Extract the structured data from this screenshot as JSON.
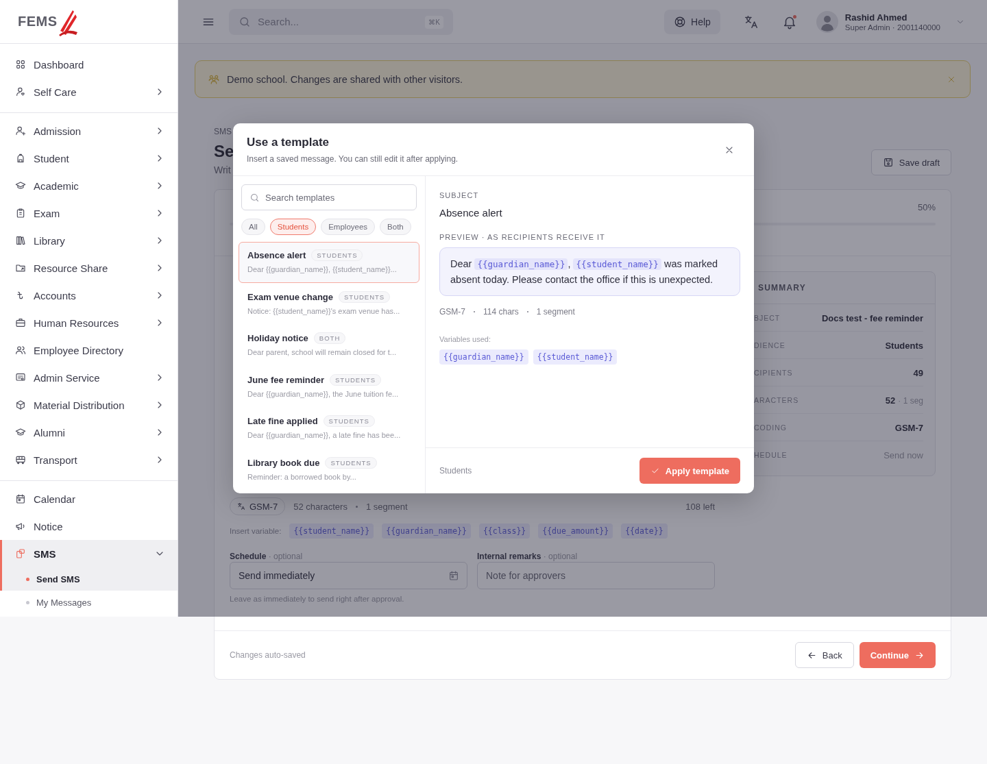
{
  "sidebar": {
    "logo": "FEMS",
    "groups": [
      {
        "items": [
          {
            "label": "Dashboard",
            "selected": false
          },
          {
            "label": "Self Care",
            "selected": false,
            "expanded": false
          }
        ]
      },
      {
        "items": [
          {
            "label": "Admission",
            "selected": false,
            "expanded": false
          },
          {
            "label": "Student",
            "selected": false,
            "expanded": false
          },
          {
            "label": "Academic",
            "selected": false,
            "expanded": false
          },
          {
            "label": "Exam",
            "selected": false,
            "expanded": false
          },
          {
            "label": "Library",
            "selected": false,
            "expanded": false
          },
          {
            "label": "Resource Share",
            "selected": false,
            "expanded": false
          },
          {
            "label": "Accounts",
            "selected": false,
            "expanded": false
          },
          {
            "label": "Human Resources",
            "selected": false,
            "expanded": false
          },
          {
            "label": "Employee Directory",
            "selected": false
          },
          {
            "label": "Admin Service",
            "selected": false,
            "expanded": false
          },
          {
            "label": "Material Distribution",
            "selected": false,
            "expanded": false
          },
          {
            "label": "Alumni",
            "selected": false,
            "expanded": false
          },
          {
            "label": "Transport",
            "selected": false,
            "expanded": false
          }
        ]
      },
      {
        "items": [
          {
            "label": "Calendar",
            "selected": false
          },
          {
            "label": "Notice",
            "selected": false
          },
          {
            "label": "SMS",
            "selected": true,
            "expanded": true,
            "children": [
              {
                "label": "Send SMS",
                "selected": true
              },
              {
                "label": "My Messages",
                "selected": false
              }
            ]
          }
        ]
      }
    ]
  },
  "topbar": {
    "search": {
      "placeholder": "Search...",
      "shortcut": "⌘K"
    },
    "help": "Help",
    "notifications_unread": true,
    "user": {
      "name": "Rashid Ahmed",
      "role": "Super Admin · 2001140000"
    }
  },
  "banner": {
    "text": "Demo school. Changes are shared with other visitors."
  },
  "page": {
    "breadcrumb": "SMS",
    "title": "Se",
    "subtitle": "Writ",
    "save_draft": "Save draft",
    "progress_reading": "50%",
    "composer": {
      "encoding": "GSM-7",
      "counters": [
        "52 characters",
        "1 segment"
      ],
      "remaining": "108 left",
      "insert_label": "Insert variable:",
      "variables": [
        "{{student_name}}",
        "{{guardian_name}}",
        "{{class}}",
        "{{due_amount}}",
        "{{date}}"
      ],
      "schedule": {
        "label": "Schedule",
        "note": "· optional",
        "value": "Send immediately",
        "hint": "Leave as immediately to send right after approval."
      },
      "remarks": {
        "label": "Internal remarks",
        "note": "· optional",
        "placeholder": "Note for approvers"
      }
    },
    "summary": {
      "title": "SUMMARY",
      "rows": [
        {
          "label": "BJECT",
          "value": "Docs test - fee reminder",
          "muted": false
        },
        {
          "label": "DIENCE",
          "value": "Students",
          "muted": false
        },
        {
          "label": "CIPIENTS",
          "value": "49",
          "muted": false
        },
        {
          "label": "ARACTERS",
          "value": "52",
          "note": "· 1 seg",
          "muted": false
        },
        {
          "label": "CODING",
          "value": "GSM-7",
          "muted": false
        },
        {
          "label": "HEDULE",
          "value": "Send now",
          "muted": true
        }
      ]
    },
    "footer": {
      "status": "Changes auto-saved",
      "back": "Back",
      "continue": "Continue"
    }
  },
  "template_dialog": {
    "title": "Use a template",
    "subtitle": "Insert a saved message. You can still edit it after applying.",
    "search": {
      "placeholder": "Search templates"
    },
    "filters": [
      {
        "label": "All",
        "selected": false
      },
      {
        "label": "Students",
        "selected": true
      },
      {
        "label": "Employees",
        "selected": false
      },
      {
        "label": "Both",
        "selected": false
      }
    ],
    "templates": [
      {
        "name": "Absence alert",
        "audience": "STUDENTS",
        "excerpt": "Dear {{guardian_name}}, {{student_name}}...",
        "selected": true
      },
      {
        "name": "Exam venue change",
        "audience": "STUDENTS",
        "excerpt": "Notice: {{student_name}}'s exam venue has...",
        "selected": false
      },
      {
        "name": "Holiday notice",
        "audience": "BOTH",
        "excerpt": "Dear parent, school will remain closed for t...",
        "selected": false
      },
      {
        "name": "June fee reminder",
        "audience": "STUDENTS",
        "excerpt": "Dear {{guardian_name}}, the June tuition fe...",
        "selected": false
      },
      {
        "name": "Late fine applied",
        "audience": "STUDENTS",
        "excerpt": "Dear {{guardian_name}}, a late fine has bee...",
        "selected": false
      },
      {
        "name": "Library book due",
        "audience": "STUDENTS",
        "excerpt": "Reminder: a borrowed book by...",
        "selected": false
      }
    ],
    "subject_label": "SUBJECT",
    "subject": "Absence alert",
    "preview_label": "PREVIEW · AS RECIPIENTS RECEIVE IT",
    "preview": [
      {
        "kind": "text",
        "text": "Dear"
      },
      {
        "kind": "variable",
        "text": "{{guardian_name}}"
      },
      {
        "kind": "text",
        "text": ","
      },
      {
        "kind": "variable",
        "text": "{{student_name}}"
      },
      {
        "kind": "text",
        "text": "was marked absent today. Please contact the office if this is unexpected."
      }
    ],
    "stats": [
      "GSM-7",
      "114 chars",
      "1 segment"
    ],
    "variables_label": "Variables used:",
    "variables": [
      "{{guardian_name}}",
      "{{student_name}}"
    ],
    "footer_audience": "Students",
    "apply_button": "Apply template"
  }
}
